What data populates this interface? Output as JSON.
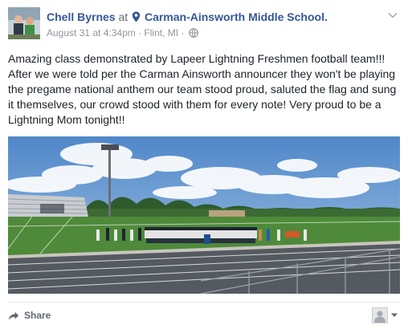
{
  "post": {
    "author": "Chell Byrnes",
    "at_word": "at",
    "place": "Carman-Ainsworth Middle School.",
    "date": "August 31 at 4:34pm",
    "separator1": " · ",
    "location": "Flint, MI",
    "separator2": " · ",
    "text": "Amazing class demonstrated by Lapeer Lightning Freshmen football team!!! After we were told per the Carman Ainsworth announcer they won't be playing the pregame national anthem our team stood proud, saluted the flag and sung it themselves, our crowd stood with them for every note! Very proud to be a Lightning Mom tonight!!"
  },
  "actions": {
    "share_label": "Share"
  },
  "icons": {
    "location": "map-pin-icon",
    "privacy": "globe-icon",
    "menu": "chevron-down-icon",
    "share": "share-arrow-icon",
    "viewer": "profile-avatar-icon",
    "viewer_menu": "caret-down-icon"
  },
  "colors": {
    "link": "#365899",
    "muted": "#90949c",
    "text": "#1d2129",
    "action": "#616770"
  }
}
